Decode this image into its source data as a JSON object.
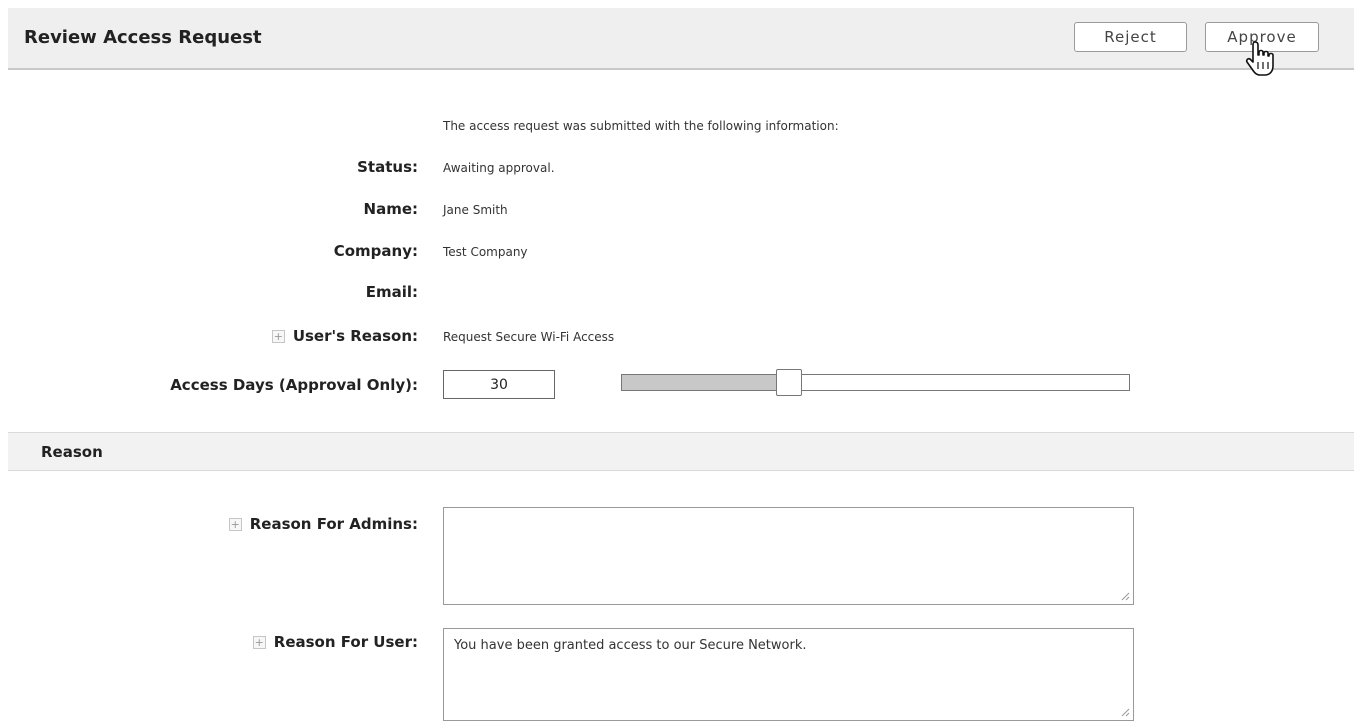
{
  "header": {
    "title": "Review Access Request",
    "reject_label": "Reject",
    "approve_label": "Approve"
  },
  "intro_text": "The access request was submitted with the following information:",
  "fields": {
    "status": {
      "label": "Status:",
      "value": "Awaiting approval."
    },
    "name": {
      "label": "Name:",
      "value": "Jane Smith"
    },
    "company": {
      "label": "Company:",
      "value": "Test Company"
    },
    "email": {
      "label": "Email:",
      "value": ""
    },
    "users_reason": {
      "label": "User's Reason:",
      "value": "Request Secure Wi-Fi Access"
    },
    "access_days": {
      "label": "Access Days (Approval Only):",
      "value": "30"
    }
  },
  "slider": {
    "fraction": 0.33
  },
  "reason_section": {
    "title": "Reason",
    "admins_label": "Reason For Admins:",
    "admins_value": "",
    "user_label": "Reason For User:",
    "user_value": "You have been granted access to our Secure Network."
  },
  "icons": {
    "expand": "plus-box-icon",
    "cursor": "hand-pointer-icon",
    "grip": "resize-grip-icon"
  }
}
